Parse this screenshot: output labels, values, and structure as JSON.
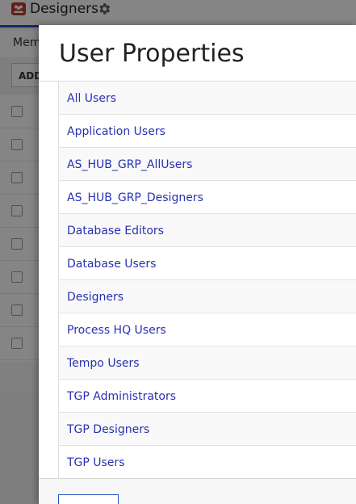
{
  "background": {
    "header_title": "Designers",
    "tab_label": "Mem",
    "add_button_label": "ADD",
    "row_count": 8
  },
  "modal": {
    "title": "User Properties",
    "groups": [
      "All Users",
      "Application Users",
      "AS_HUB_GRP_AllUsers",
      "AS_HUB_GRP_Designers",
      "Database Editors",
      "Database Users",
      "Designers",
      "Process HQ Users",
      "Tempo Users",
      "TGP Administrators",
      "TGP Designers",
      "TGP Users"
    ]
  },
  "colors": {
    "link": "#2732b0",
    "accent": "#2a52be",
    "group_icon": "#c0392b"
  },
  "icons": {
    "group": "group-icon",
    "settings": "gear-icon"
  }
}
